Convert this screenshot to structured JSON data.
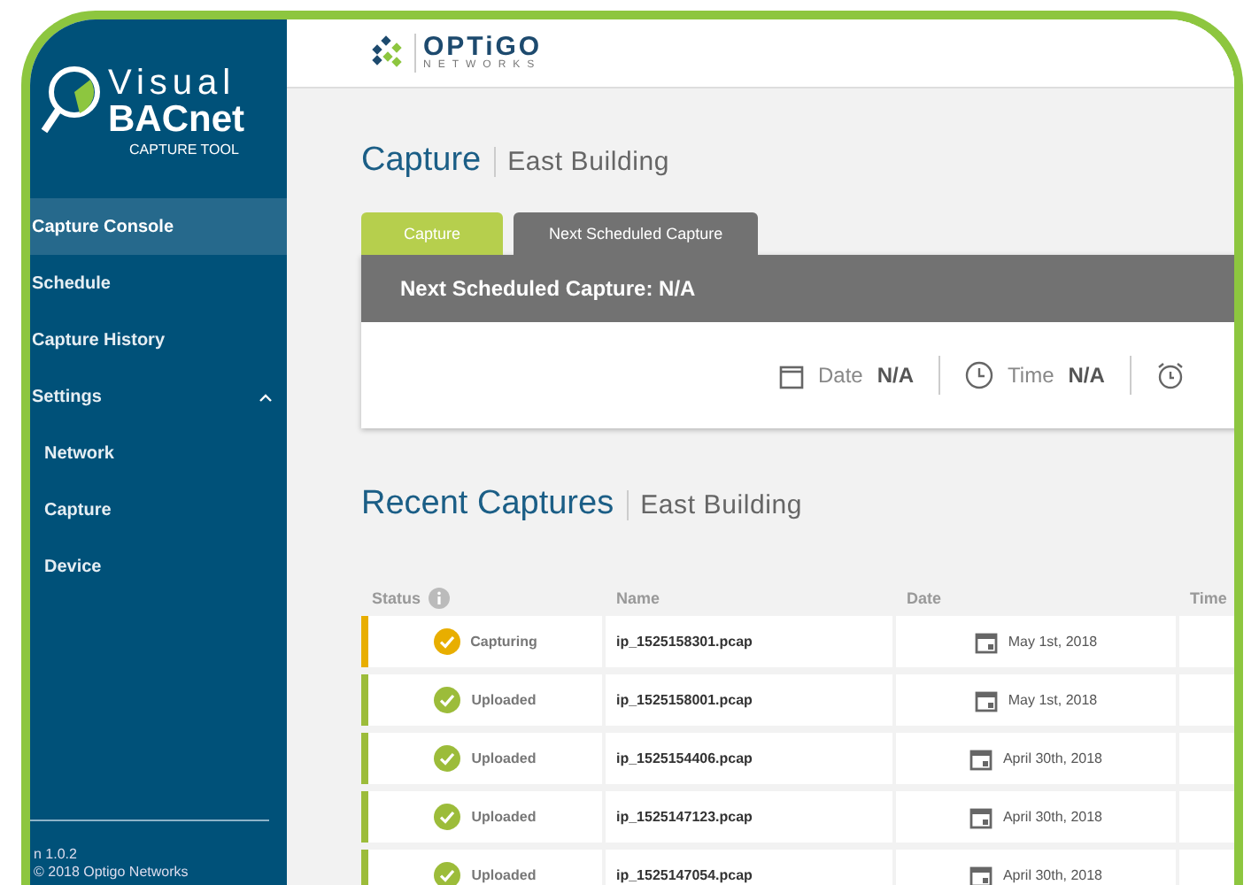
{
  "sidebar": {
    "brand": {
      "line1": "Visual",
      "line2": "BACnet",
      "tagline": "CAPTURE TOOL"
    },
    "items": [
      {
        "label": "Capture Console",
        "selected": true
      },
      {
        "label": "Schedule",
        "selected": false
      },
      {
        "label": "Capture History",
        "selected": false
      },
      {
        "label": "Settings",
        "selected": false,
        "expanded": true,
        "children": [
          {
            "label": "Network",
            "selected": false
          },
          {
            "label": "Capture",
            "selected": false
          },
          {
            "label": "Device",
            "selected": false
          }
        ]
      }
    ],
    "footer": {
      "version": "n 1.0.2",
      "copyright": "© 2018 Optigo Networks"
    }
  },
  "header": {
    "logo_name": "OPTiGO",
    "logo_sub": "NETWORKS"
  },
  "capture": {
    "title": "Capture",
    "subtitle": "East Building",
    "tabs": [
      {
        "label": "Capture",
        "selected": true
      },
      {
        "label": "Next Scheduled Capture",
        "selected": false
      }
    ],
    "card": {
      "heading": "Next Scheduled Capture: N/A",
      "fields": [
        {
          "kind": "date",
          "label": "Date",
          "value": "N/A"
        },
        {
          "kind": "time",
          "label": "Time",
          "value": "N/A"
        },
        {
          "kind": "alarm"
        }
      ]
    }
  },
  "recent": {
    "title": "Recent Captures",
    "subtitle": "East Building",
    "columns": [
      "Status",
      "Name",
      "Date",
      "Time"
    ],
    "rows": [
      {
        "status": "Capturing",
        "color": "#e8ae00",
        "name": "ip_1525158301.pcap",
        "date": "May 1st, 2018"
      },
      {
        "status": "Uploaded",
        "color": "#9cbc3a",
        "name": "ip_1525158001.pcap",
        "date": "May 1st, 2018"
      },
      {
        "status": "Uploaded",
        "color": "#9cbc3a",
        "name": "ip_1525154406.pcap",
        "date": "April 30th, 2018"
      },
      {
        "status": "Uploaded",
        "color": "#9cbc3a",
        "name": "ip_1525147123.pcap",
        "date": "April 30th, 2018"
      },
      {
        "status": "Uploaded",
        "color": "#9cbc3a",
        "name": "ip_1525147054.pcap",
        "date": "April 30th, 2018"
      }
    ]
  }
}
